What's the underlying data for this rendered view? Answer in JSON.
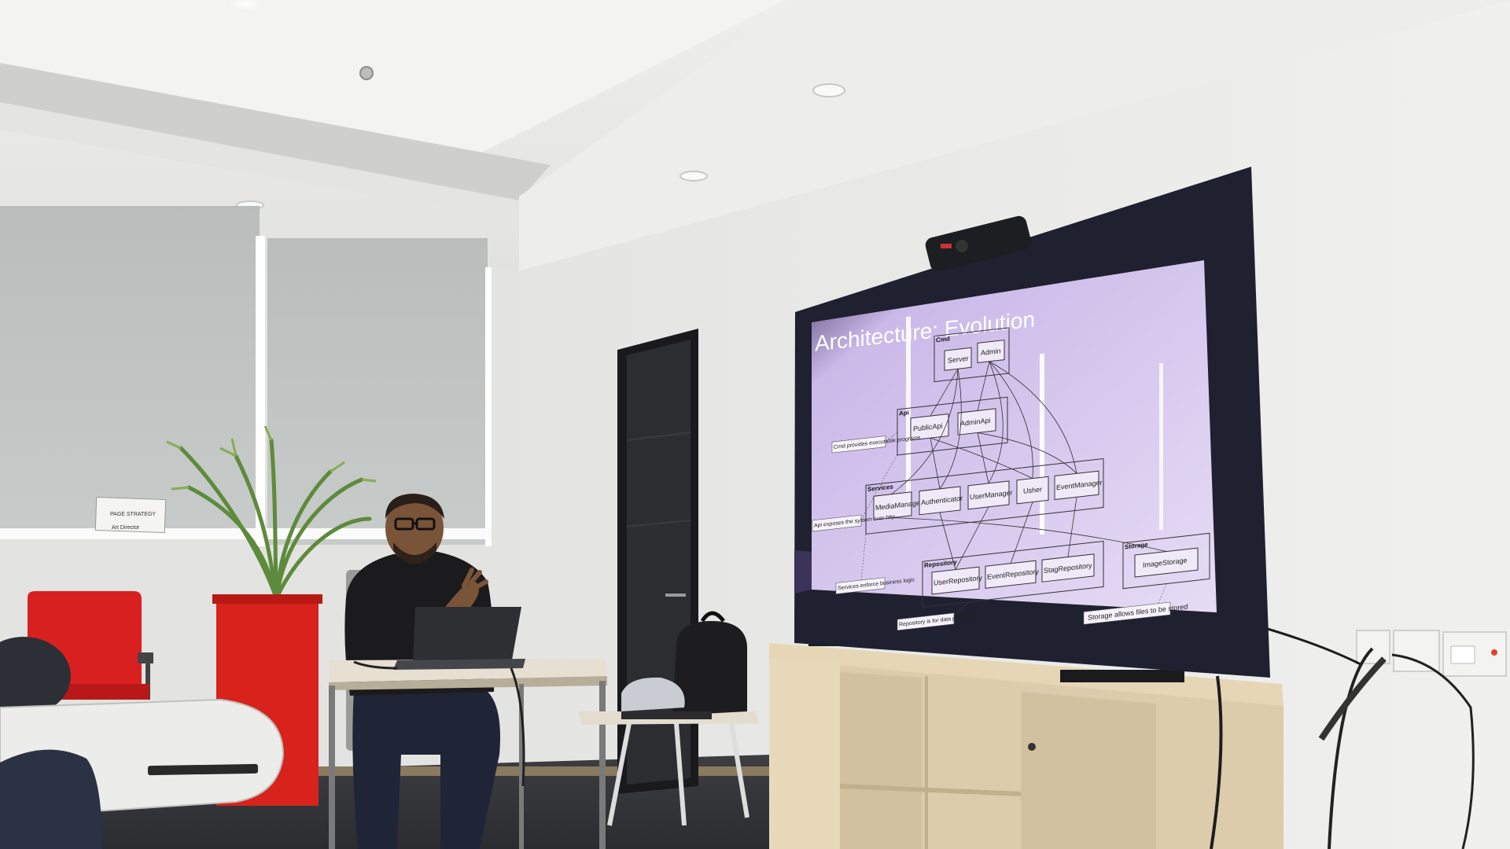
{
  "slide": {
    "title": "Architecture: Evolution",
    "groups": {
      "cmd": "Cmd",
      "api": "Api",
      "services": "Services",
      "repository": "Repository",
      "storage": "Storage"
    },
    "boxes": {
      "server": "Server",
      "admin": "Admin",
      "publicapi": "PublicApi",
      "adminapi": "AdminApi",
      "mediamanager": "MediaManager",
      "authenticator": "Authenticator",
      "usermanager": "UserManager",
      "usher": "Usher",
      "eventmanager": "EventManager",
      "userrepository": "UserRepository",
      "eventrepository": "EventRepository",
      "stagrepository": "StagRepository",
      "imagestorage": "ImageStorage"
    },
    "notes": {
      "api_note": "Cmd provides executable programs",
      "services_note": "Api exposes the system over http",
      "service_logic_note": "Services enforce business logic",
      "repository_note": "Repository is for data persistence",
      "storage_note": "Storage allows files to be stored"
    }
  },
  "window_sign": {
    "line1": "PAGE STRATEGY",
    "line2": "Art Director"
  },
  "colors": {
    "wall": "#e6e6e4",
    "ceiling": "#f1f1ef",
    "screen_bezel": "#1e1f2e",
    "slide_bg": "#d9c8ef",
    "slide_dark": "#3a2f55",
    "chair_red": "#d92020",
    "planter_red": "#d8231c",
    "cabinet": "#ddccac",
    "shirt": "#1b1b1e"
  }
}
